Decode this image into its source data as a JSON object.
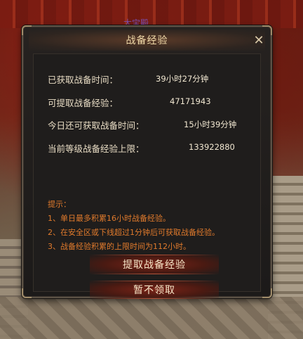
{
  "scene": {
    "label": "太宝殿"
  },
  "dialog": {
    "title": "战备经验",
    "close_icon": "close-icon",
    "rows": [
      {
        "label": "已获取战备时间：",
        "value": "39小时27分钟"
      },
      {
        "label": "可提取战备经验：",
        "value": "47171943"
      },
      {
        "label": "今日还可获取战备时间：",
        "value": "15小时39分钟"
      },
      {
        "label": "当前等级战备经验上限：",
        "value": "133922880"
      }
    ],
    "tips": {
      "heading": "提示：",
      "items": [
        "1、单日最多积累16小时战备经验。",
        "2、在安全区或下线超过1分钟后可获取战备经验。",
        "3、战备经验积累的上限时间为112小时。"
      ]
    },
    "buttons": {
      "extract": "提取战备经验",
      "decline": "暂不领取"
    }
  },
  "colors": {
    "label": "#e8dcc4",
    "tips": "#e07a2c",
    "title": "#f0d9a8"
  }
}
